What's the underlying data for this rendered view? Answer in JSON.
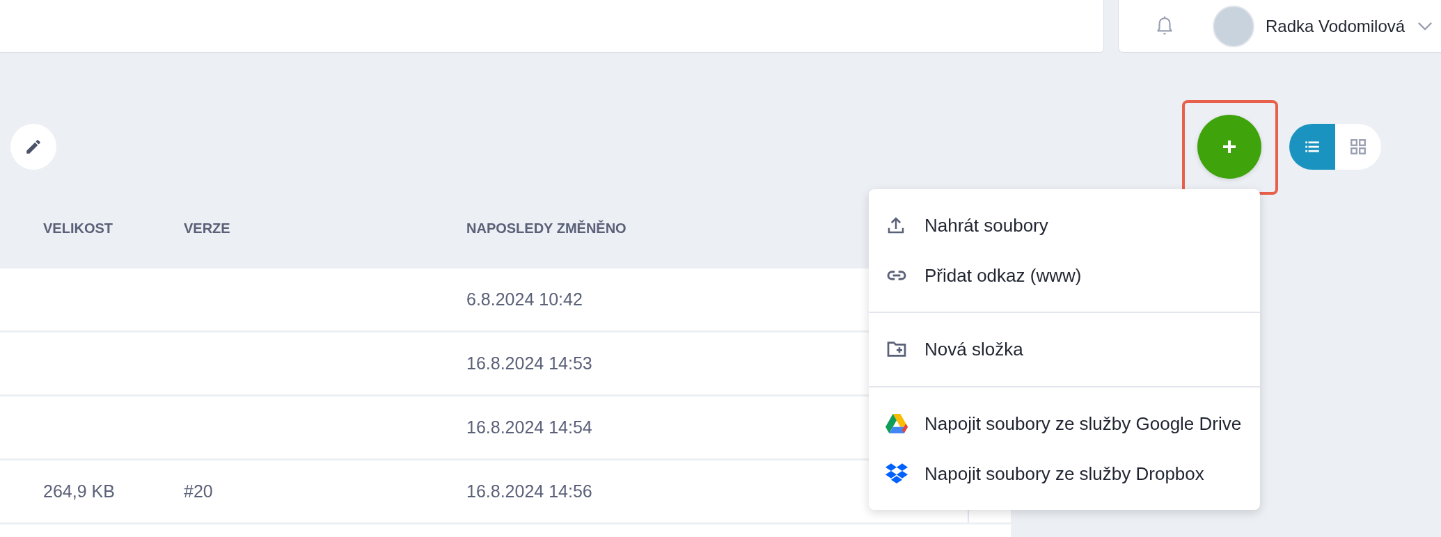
{
  "header": {
    "user_name": "Radka Vodomilová"
  },
  "view_toggle": [
    {
      "kind": "list",
      "selected": true
    },
    {
      "kind": "grid",
      "selected": false
    }
  ],
  "table": {
    "columns": [
      "VELIKOST",
      "VERZE",
      "NAPOSLEDY ZMĚNĚNO"
    ],
    "rows": [
      {
        "size": "",
        "version": "",
        "modified": "6.8.2024 10:42"
      },
      {
        "size": "",
        "version": "",
        "modified": "16.8.2024 14:53"
      },
      {
        "size": "",
        "version": "",
        "modified": "16.8.2024 14:54"
      },
      {
        "size": "264,9 KB",
        "version": "#20",
        "modified": "16.8.2024 14:56"
      }
    ]
  },
  "add_menu": {
    "groups": [
      [
        {
          "kind": "upload",
          "label": "Nahrát soubory"
        },
        {
          "kind": "link",
          "label": "Přidat odkaz (www)"
        }
      ],
      [
        {
          "kind": "folder",
          "label": "Nová složka"
        }
      ],
      [
        {
          "kind": "gdrive",
          "label": "Napojit soubory ze služby Google Drive"
        },
        {
          "kind": "dropbox",
          "label": "Napojit soubory ze služby Dropbox"
        }
      ]
    ]
  }
}
